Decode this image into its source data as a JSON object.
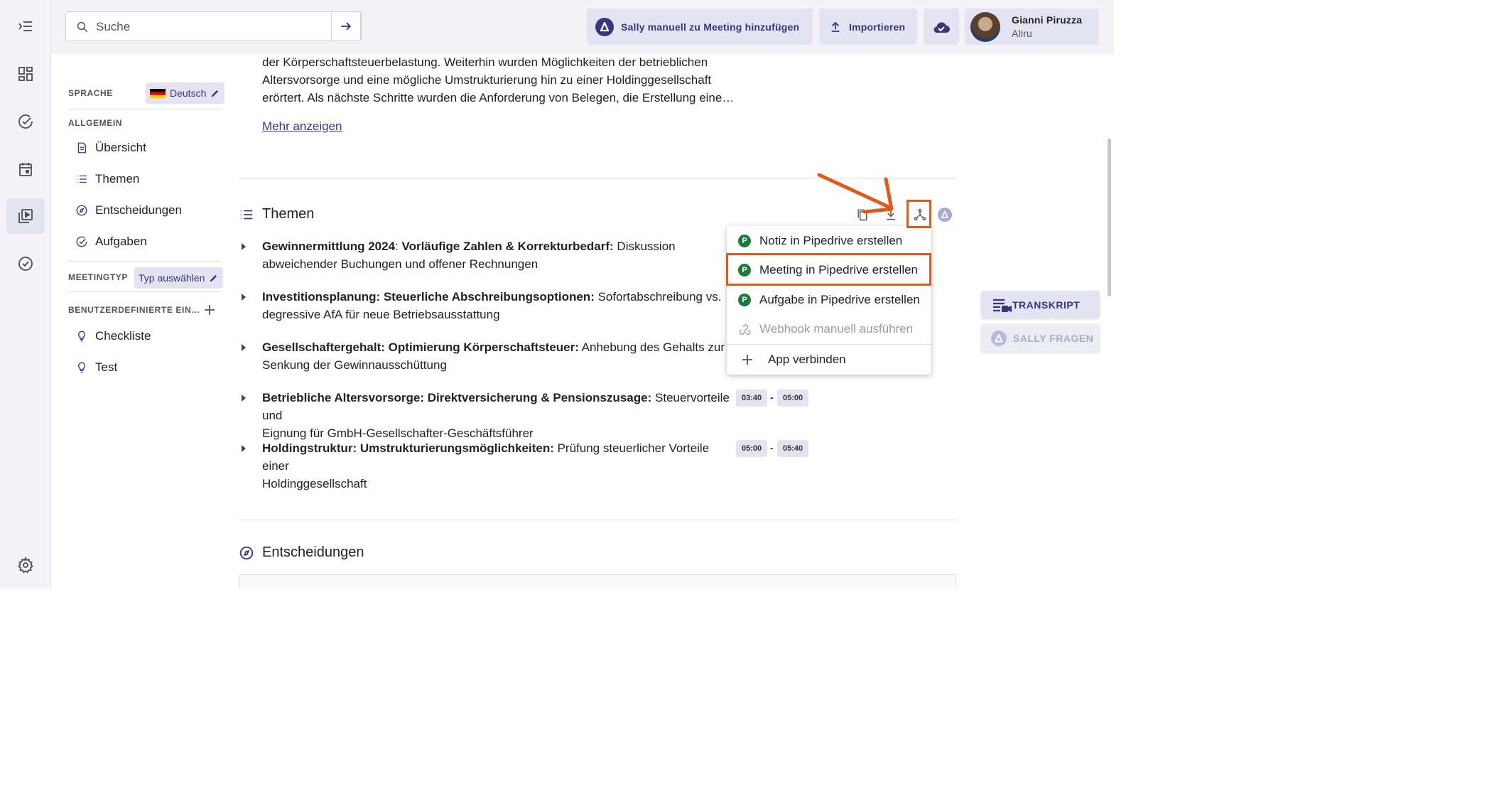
{
  "topbar": {
    "search_placeholder": "Suche",
    "sally_button_label": "Sally manuell zu Meeting hinzufügen",
    "import_button_label": "Importieren",
    "user_name": "Gianni Piruzza",
    "user_org": "Aliru"
  },
  "sidebar": {
    "language_heading": "SPRACHE",
    "language_value": "Deutsch",
    "general_heading": "ALLGEMEIN",
    "general_items": [
      "Übersicht",
      "Themen",
      "Entscheidungen",
      "Aufgaben"
    ],
    "meeting_type_heading": "MEETINGTYP",
    "meeting_type_value": "Typ auswählen",
    "custom_heading": "BENUTZERDEFINIERTE EIN…",
    "custom_items": [
      "Checkliste",
      "Test"
    ]
  },
  "summary": {
    "text_lines": [
      "der Körperschaftsteuerbelastung. Weiterhin wurden Möglichkeiten der betrieblichen",
      "Altersvorsorge und eine mögliche Umstrukturierung hin zu einer Holdinggesellschaft",
      "erörtert. Als nächste Schritte wurden die Anforderung von Belegen, die Erstellung eine…"
    ],
    "more_link": "Mehr anzeigen"
  },
  "topics_section": {
    "title": "Themen",
    "items": [
      {
        "title": "Gewinnermittlung 2024",
        "subtitle": ": ",
        "subtitle_bold": "Vorläufige Zahlen & Korrekturbedarf:",
        "text_line1": " Diskussion",
        "text_line2": "abweichender Buchungen und offener Rechnungen"
      },
      {
        "title": "Investitionsplanung: Steuerliche Abschreibungsoptionen:",
        "text_line1": " Sofortabschreibung vs.",
        "text_line2": "degressive AfA für neue Betriebsausstattung"
      },
      {
        "title": "Gesellschaftergehalt: Optimierung Körperschaftsteuer:",
        "text_line1": " Anhebung des Gehalts zur",
        "text_line2": "Senkung der Gewinnausschüttung"
      },
      {
        "title": "Betriebliche Altersvorsorge: Direktversicherung & Pensionszusage:",
        "text_line1": " Steuervorteile und",
        "text_line2": "Eignung für GmbH-Gesellschafter-Geschäftsführer",
        "start": "03:40",
        "end": "05:00"
      },
      {
        "title": "Holdingstruktur: Umstrukturierungsmöglichkeiten:",
        "text_line1": " Prüfung steuerlicher Vorteile einer",
        "text_line2": "Holdinggesellschaft",
        "start": "05:00",
        "end": "05:40"
      }
    ],
    "time_separator": "-"
  },
  "menu": {
    "items": [
      "Notiz in Pipedrive erstellen",
      "Meeting in Pipedrive erstellen",
      "Aufgabe in Pipedrive erstellen",
      "Webhook manuell ausführen",
      "App verbinden"
    ],
    "pd_badge": "P"
  },
  "decisions_section": {
    "title": "Entscheidungen"
  },
  "side_buttons": {
    "transcript": "TRANSKRIPT",
    "ask_sally": "SALLY FRAGEN"
  },
  "colors": {
    "accent": "#3a3580",
    "highlight": "#e05a1a",
    "pipedrive": "#1b7a3e"
  }
}
